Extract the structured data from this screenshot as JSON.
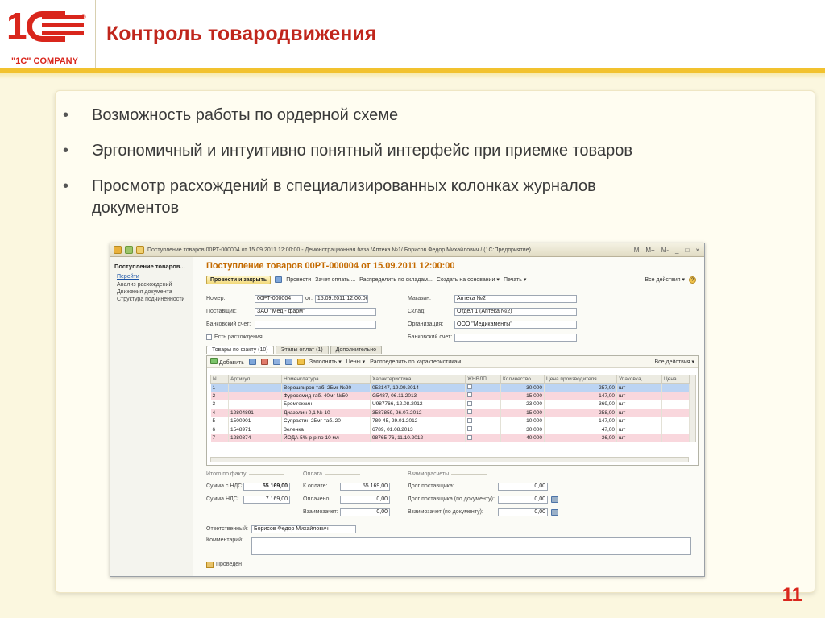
{
  "logo": {
    "company": "\"1C\" COMPANY",
    "reg": "®"
  },
  "slide": {
    "title": "Контроль товародвижения",
    "page_number": "11"
  },
  "bullets": [
    "Возможность работы по ордерной схеме",
    "Эргономичный и интуитивно понятный интерфейс при приемке товаров",
    "Просмотр расхождений в специализированных колонках журналов документов"
  ],
  "app": {
    "window_title": "Поступление товаров 00РТ-000004 от 15.09.2011 12:00:00 - Демонстрационная база /Аптека №1/ Борисов Федор Михайлович / (1С:Предприятие)",
    "window_buttons": [
      "M",
      "M+",
      "M-",
      "_",
      "□",
      "×"
    ],
    "nav": {
      "header": "Поступление товаров...",
      "go_label": "Перейти",
      "items": [
        "Анализ расхождений",
        "Движения документа",
        "Структура подчиненности"
      ]
    },
    "form_title": "Поступление товаров 00РТ-000004 от 15.09.2011 12:00:00",
    "commands": {
      "post_close": "Провести и закрыть",
      "post": "Провести",
      "payment_offset": "Зачет оплаты...",
      "distribute": "Распределить по складам...",
      "create_based": "Создать на основании ▾",
      "print": "Печать ▾",
      "all_actions": "Все действия ▾",
      "help": "?"
    },
    "fields": {
      "number_label": "Номер:",
      "number": "00РТ-000004",
      "date_label": "от:",
      "date": "15.09.2011 12:00:00",
      "store_label": "Магазин:",
      "store": "Аптека №2",
      "supplier_label": "Поставщик:",
      "supplier": "ЗАО \"Мед - фарм\"",
      "warehouse_label": "Склад:",
      "warehouse": "Отдел 1 (Аптека №2)",
      "bank_label": "Банковский счет:",
      "bank": "",
      "org_label": "Организация:",
      "org": "ООО \"Медикаменты\"",
      "disc_label": "Есть расхождения",
      "bank2_label": "Банковский счет:",
      "bank2": ""
    },
    "tabs": [
      "Товары по факту (10)",
      "Этапы оплат (1)",
      "Дополнительно"
    ],
    "table_commands": {
      "add": "Добавить",
      "fill": "Заполнить ▾",
      "prices": "Цены ▾",
      "distribute_char": "Распределить по характеристикам...",
      "all_actions": "Все действия ▾"
    },
    "columns": [
      "N",
      "Артикул",
      "Номенклатура",
      "Характеристика",
      "ЖНВЛП",
      "Количество",
      "Цена производителя",
      "Упаковка,",
      "Цена"
    ],
    "rows": [
      {
        "n": "1",
        "article": "",
        "name": "Верошпирон таб. 25мг №20",
        "char": "052147, 19.09.2014",
        "qty": "30,000",
        "price": "257,00",
        "pack": "шт"
      },
      {
        "n": "2",
        "article": "",
        "name": "Фуросемид таб. 40мг №50",
        "char": "G5487, 06.11.2013",
        "qty": "15,000",
        "price": "147,00",
        "pack": "шт"
      },
      {
        "n": "3",
        "article": "",
        "name": "Бромгексин",
        "char": "U987766, 12.08.2012",
        "qty": "23,000",
        "price": "369,00",
        "pack": "шт"
      },
      {
        "n": "4",
        "article": "12804891",
        "name": "Диазолин 0,1 № 10",
        "char": "3587859, 26.07.2012",
        "qty": "15,000",
        "price": "258,00",
        "pack": "шт"
      },
      {
        "n": "5",
        "article": "1500901",
        "name": "Супрастин 25мг таб. 20",
        "char": "789-45, 29.01.2012",
        "qty": "10,000",
        "price": "147,00",
        "pack": "шт"
      },
      {
        "n": "6",
        "article": "1548971",
        "name": "Зеленка",
        "char": "6789, 01.08.2013",
        "qty": "30,000",
        "price": "47,00",
        "pack": "шт"
      },
      {
        "n": "7",
        "article": "1280874",
        "name": "ЙОДА 5% р-р по 10 мл",
        "char": "98765-76, 11.10.2012",
        "qty": "40,000",
        "price": "36,00",
        "pack": "шт"
      }
    ],
    "totals": {
      "fact_group": "Итого по факту",
      "pay_group": "Оплата",
      "settle_group": "Взаиморасчеты",
      "sum_vat_label": "Сумма с НДС:",
      "sum_vat": "55 169,00",
      "vat_label": "Сумма НДС:",
      "vat": "7 169,00",
      "to_pay_label": "К оплате:",
      "to_pay": "55 169,00",
      "paid_label": "Оплачено:",
      "paid": "0,00",
      "offset_label": "Взаимозачет:",
      "offset": "0,00",
      "debt_label": "Долг поставщика:",
      "debt": "0,00",
      "debt_doc_label": "Долг поставщика (по документу):",
      "debt_doc": "0,00",
      "offset_doc_label": "Взаимозачет (по документу):",
      "offset_doc": "0,00"
    },
    "responsible_label": "Ответственный:",
    "responsible": "Борисов Федор Михайлович",
    "comment_label": "Комментарий:",
    "status": "Проведен"
  }
}
